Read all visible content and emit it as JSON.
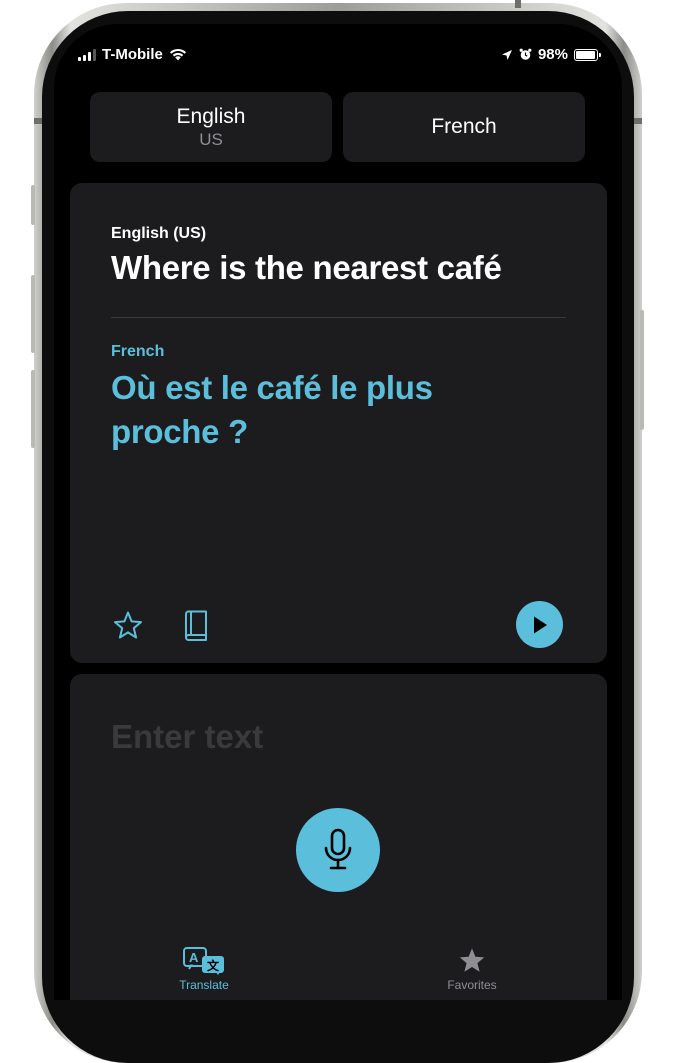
{
  "status_bar": {
    "carrier": "T-Mobile",
    "battery": "98%",
    "battery_level": 0.98
  },
  "languages": {
    "source": {
      "name": "English",
      "region": "US"
    },
    "target": {
      "name": "French"
    }
  },
  "translation": {
    "source_label": "English (US)",
    "source_text": "Where is the nearest café",
    "target_label": "French",
    "target_text": "Où est le café le plus proche ?"
  },
  "input": {
    "placeholder": "Enter text"
  },
  "tab_bar": {
    "translate": "Translate",
    "favorites": "Favorites"
  },
  "colors": {
    "accent": "#5bbfdc",
    "card_bg": "#1c1c1e",
    "screen_bg": "#000000",
    "inactive_tab": "#8e8e93"
  }
}
